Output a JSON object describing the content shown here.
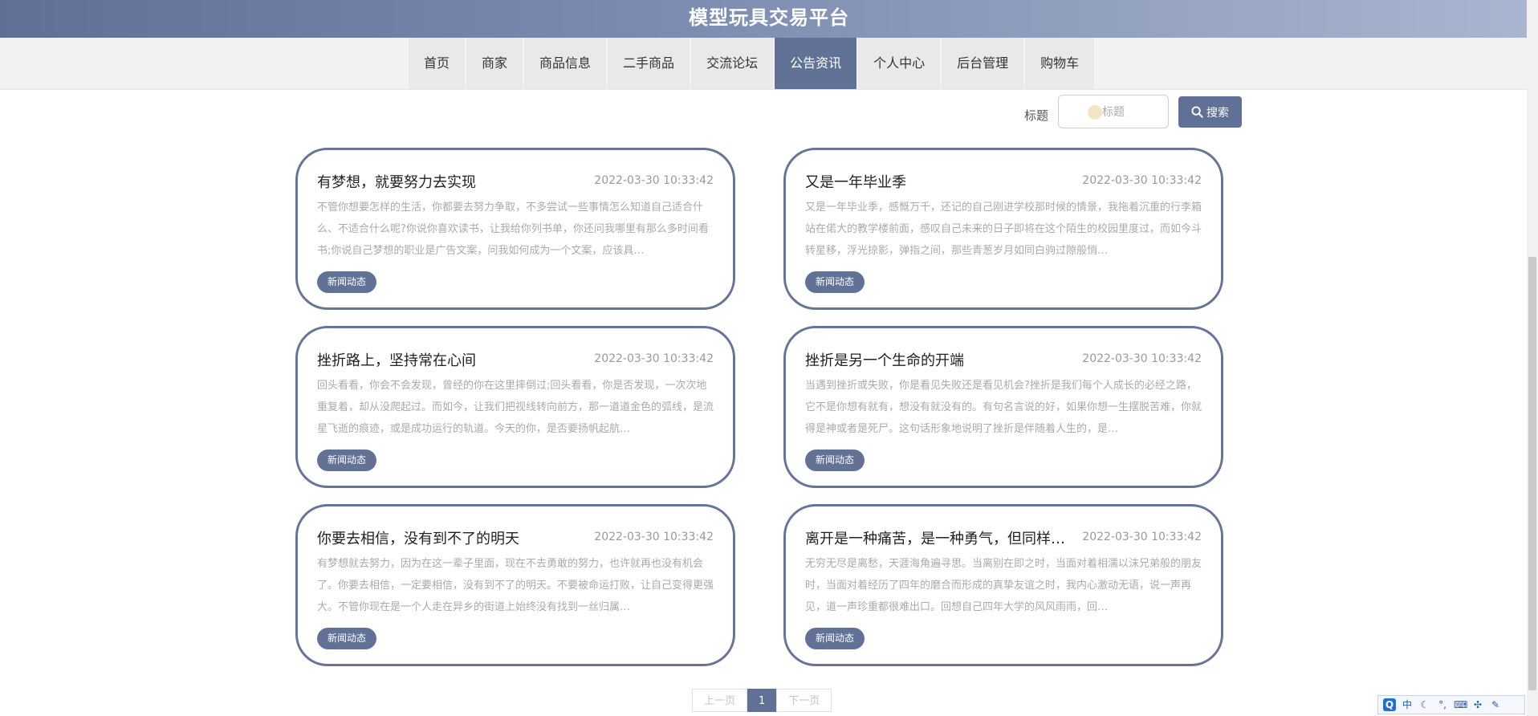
{
  "header": {
    "title": "模型玩具交易平台"
  },
  "nav": {
    "items": [
      {
        "label": "首页"
      },
      {
        "label": "商家"
      },
      {
        "label": "商品信息"
      },
      {
        "label": "二手商品"
      },
      {
        "label": "交流论坛"
      },
      {
        "label": "公告资讯"
      },
      {
        "label": "个人中心"
      },
      {
        "label": "后台管理"
      },
      {
        "label": "购物车"
      }
    ],
    "active": "公告资讯"
  },
  "search": {
    "label": "标题",
    "placeholder": "标题",
    "value": "",
    "button_label": "搜索"
  },
  "articles": [
    {
      "title": "有梦想，就要努力去实现",
      "date": "2022-03-30 10:33:42",
      "summary": "不管你想要怎样的生活，你都要去努力争取，不多尝试一些事情怎么知道自己适合什么、不适合什么呢?你说你喜欢读书，让我给你列书单，你还问我哪里有那么多时间看书;你说自己梦想的职业是广告文案，问我如何成为一个文案，应该具…",
      "tag": "新闻动态"
    },
    {
      "title": "又是一年毕业季",
      "date": "2022-03-30 10:33:42",
      "summary": "又是一年毕业季，感慨万千，还记的自己刚进学校那时候的情景，我拖着沉重的行李箱站在偌大的教学楼前面，感叹自己未来的日子即将在这个陌生的校园里度过，而如今斗转星移，浮光掠影，弹指之间，那些青葱岁月如同白驹过隙般悄…",
      "tag": "新闻动态"
    },
    {
      "title": "挫折路上，坚持常在心间",
      "date": "2022-03-30 10:33:42",
      "summary": "回头看看，你会不会发现，曾经的你在这里摔倒过;回头看看，你是否发现，一次次地重复着，却从没爬起过。而如今，让我们把视线转向前方，那一道道金色的弧线，是流星飞逝的痕迹，或是成功运行的轨道。今天的你，是否要扬帆起航…",
      "tag": "新闻动态"
    },
    {
      "title": "挫折是另一个生命的开端",
      "date": "2022-03-30 10:33:42",
      "summary": "当遇到挫折或失败，你是看见失败还是看见机会?挫折是我们每个人成长的必经之路，它不是你想有就有，想没有就没有的。有句名言说的好，如果你想一生摆脱苦难，你就得是神或者是死尸。这句话形象地说明了挫折是伴随着人生的，是…",
      "tag": "新闻动态"
    },
    {
      "title": "你要去相信，没有到不了的明天",
      "date": "2022-03-30 10:33:42",
      "summary": "有梦想就去努力，因为在这一辈子里面，现在不去勇敢的努力，也许就再也没有机会了。你要去相信，一定要相信，没有到不了的明天。不要被命运打败，让自己变得更强大。不管你现在是一个人走在异乡的街道上始终没有找到一丝归属…",
      "tag": "新闻动态"
    },
    {
      "title": "离开是一种痛苦，是一种勇气，但同样也是…",
      "date": "2022-03-30 10:33:42",
      "summary": "无穷无尽是离愁，天涯海角遍寻思。当离别在即之时，当面对着相濡以沫兄弟般的朋友时，当面对着经历了四年的磨合而形成的真挚友谊之时，我内心激动无语，说一声再见，道一声珍重都很难出口。回想自己四年大学的风风雨雨，回…",
      "tag": "新闻动态"
    }
  ],
  "pagination": {
    "prev_label": "上一页",
    "current_page": "1",
    "next_label": "下一页"
  },
  "ime": {
    "lang_label": "中"
  }
}
